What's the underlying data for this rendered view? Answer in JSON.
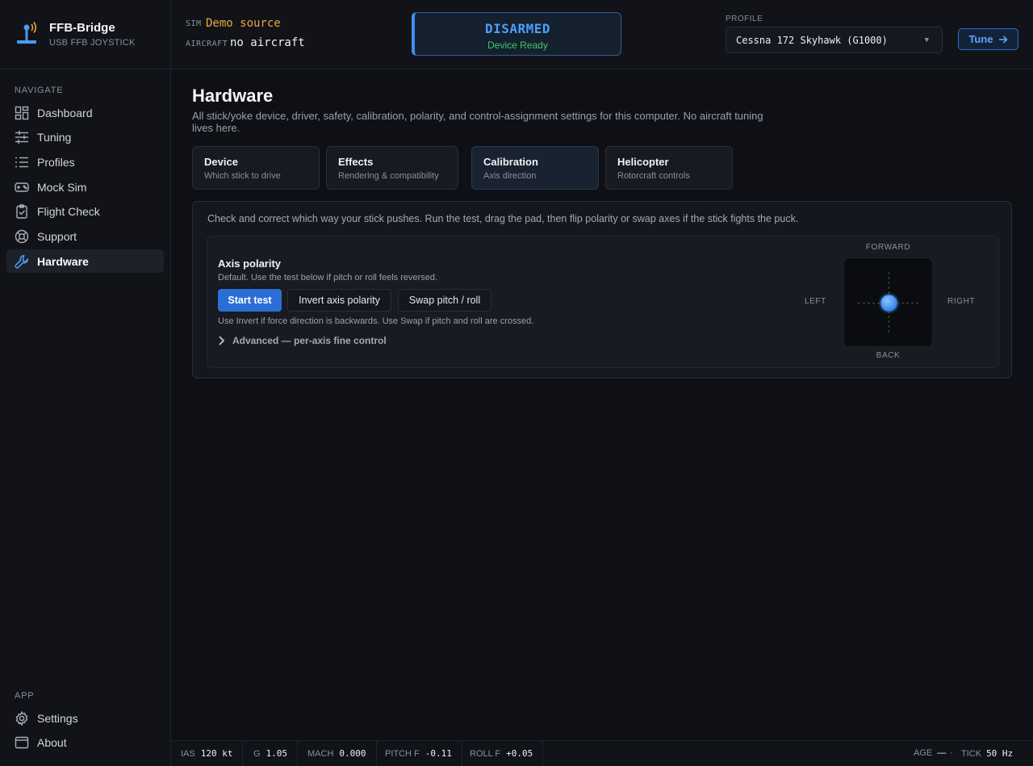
{
  "brand": {
    "name": "FFB-Bridge",
    "subtitle": "USB FFB JOYSTICK"
  },
  "sidebar": {
    "navigate_title": "NAVIGATE",
    "nav": [
      {
        "label": "Dashboard",
        "icon": "dashboard-icon"
      },
      {
        "label": "Tuning",
        "icon": "sliders-icon"
      },
      {
        "label": "Profiles",
        "icon": "list-icon"
      },
      {
        "label": "Mock Sim",
        "icon": "gamepad-icon"
      },
      {
        "label": "Flight Check",
        "icon": "clipboard-check-icon"
      },
      {
        "label": "Support",
        "icon": "lifebuoy-icon"
      },
      {
        "label": "Hardware",
        "icon": "wrench-icon",
        "active": true
      }
    ],
    "app_title": "APP",
    "app": [
      {
        "label": "Settings",
        "icon": "gear-icon"
      },
      {
        "label": "About",
        "icon": "window-icon"
      }
    ]
  },
  "topbar": {
    "sim_label": "SIM",
    "sim_value": "Demo source",
    "aircraft_label": "AIRCRAFT",
    "aircraft_value": "no aircraft",
    "status_main": "DISARMED",
    "status_sub": "Device Ready",
    "profile_label": "PROFILE",
    "profile_value": "Cessna 172 Skyhawk (G1000)",
    "tune_label": "Tune"
  },
  "main": {
    "title": "Hardware",
    "description": "All stick/yoke device, driver, safety, calibration, polarity, and control-assignment settings for this computer. No aircraft tuning lives here.",
    "tabs": [
      {
        "name": "Device",
        "sub": "Which stick to drive"
      },
      {
        "name": "Effects",
        "sub": "Rendering & compatibility"
      },
      {
        "name": "Calibration",
        "sub": "Axis direction",
        "active": true
      },
      {
        "name": "Helicopter",
        "sub": "Rotorcraft controls"
      }
    ],
    "panel": {
      "intro": "Check and correct which way your stick pushes. Run the test, drag the pad, then flip polarity or swap axes if the stick fights the puck.",
      "title": "Axis polarity",
      "desc": "Default. Use the test below if pitch or roll feels reversed.",
      "buttons": {
        "start": "Start test",
        "invert": "Invert axis polarity",
        "swap": "Swap pitch / roll"
      },
      "help": "Use Invert if force direction is backwards. Use Swap if pitch and roll are crossed.",
      "advanced": "Advanced — per-axis fine control",
      "pad": {
        "forward": "FORWARD",
        "back": "BACK",
        "left": "LEFT",
        "right": "RIGHT",
        "puck_x": 0,
        "puck_y": 0
      }
    }
  },
  "statusbar": {
    "ias_label": "IAS",
    "ias_value": "120 kt",
    "g_label": "G",
    "g_value": "1.05",
    "mach_label": "MACH",
    "mach_value": "0.000",
    "pitch_label": "PITCH F",
    "pitch_value": "-0.11",
    "roll_label": "ROLL F",
    "roll_value": "+0.05",
    "age_label": "AGE",
    "age_value": "—",
    "sep": "·",
    "tick_label": "TICK",
    "tick_value": "50 Hz"
  },
  "colors": {
    "accent": "#3f8ef0",
    "sim": "#f0a63a",
    "ready": "#3fc96b",
    "primary_button": "#2b6fd6"
  }
}
